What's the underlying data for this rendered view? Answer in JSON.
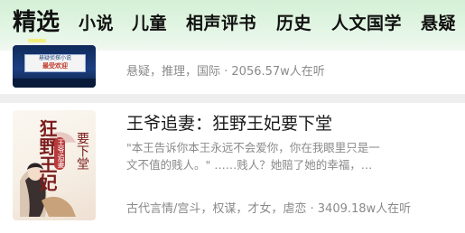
{
  "tabs": [
    {
      "label": "精选",
      "active": true
    },
    {
      "label": "小说"
    },
    {
      "label": "儿童"
    },
    {
      "label": "相声评书"
    },
    {
      "label": "历史"
    },
    {
      "label": "人文国学"
    },
    {
      "label": "悬疑"
    }
  ],
  "items": [
    {
      "cover_text": {
        "line1": "悬疑侦探小说",
        "line2": "最受欢迎"
      },
      "meta": "悬疑，推理，国际 · 2056.57w人在听"
    },
    {
      "title": "王爷追妻：狂野王妃要下堂",
      "desc_line1": "\"本王告诉你本王永远不会爱你，你在我眼里只是一",
      "desc_line2": "文不值的贱人。\"      ……贱人？她赔了她的幸福，…",
      "meta": "古代言情/宫斗，权谋，才女，虐恋 · 3409.18w人在听",
      "cover_text": {
        "main": "狂野王妃",
        "sub": "要下堂",
        "tag": "王爷追妻"
      }
    }
  ],
  "colors": {
    "header_green": "#d4f0d6",
    "indicator": "#f2ed7c",
    "divider": "#eeeeee"
  }
}
